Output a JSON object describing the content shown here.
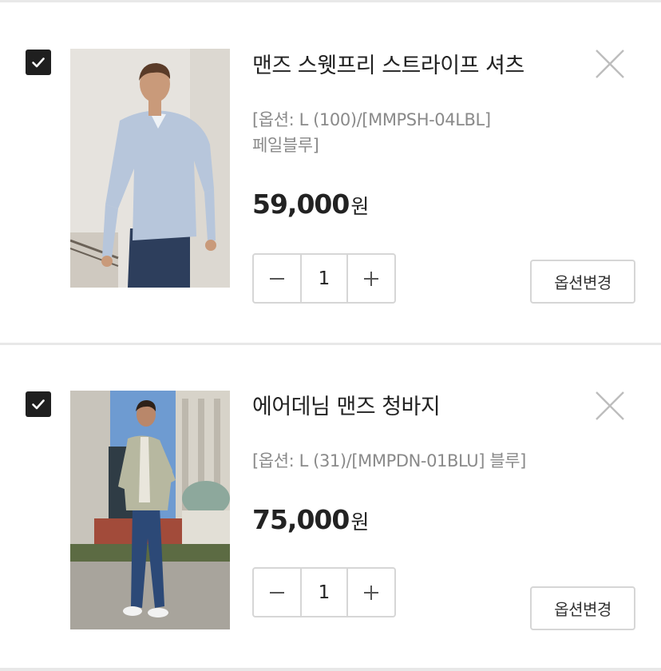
{
  "cart": {
    "items": [
      {
        "name": "맨즈 스웻프리 스트라이프 셔츠",
        "option_lines": [
          "[옵션: L (100)/[MMPSH-04LBL]",
          "페일블루]"
        ],
        "price": "59,000",
        "currency": "원",
        "quantity": "1",
        "change_option_label": "옵션변경",
        "checked": true,
        "image": "man-in-blue-shirt-photo"
      },
      {
        "name": "에어데님 맨즈 청바지",
        "option_lines": [
          "[옵션: L (31)/[MMPDN-01BLU] 블루]"
        ],
        "price": "75,000",
        "currency": "원",
        "quantity": "1",
        "change_option_label": "옵션변경",
        "checked": true,
        "image": "man-in-jeans-city-photo"
      }
    ]
  },
  "icons": {
    "checkbox": "check-icon",
    "remove": "close-icon",
    "decrease": "minus-icon",
    "increase": "plus-icon"
  },
  "colors": {
    "checkbox_fill": "#1f1f1f",
    "border": "#d6d6d6",
    "option_text": "#8a8a8a",
    "close_icon": "#bdbdbd"
  }
}
